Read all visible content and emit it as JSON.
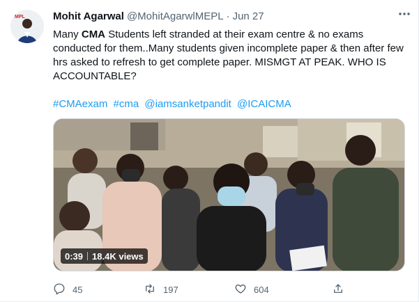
{
  "tweet": {
    "author_name": "Mohit Agarwal",
    "author_handle": "@MohitAgarwlMEPL",
    "separator": "·",
    "time": "Jun 27",
    "avatar_badge_text": "MPL",
    "text_line_prefix": "Many ",
    "text_bold": "CMA",
    "text_rest": " Students left stranded at their exam centre & no exams conducted for them..Many students given incomplete paper & then after few hrs asked to refresh to get complete paper. MISMGT AT PEAK. WHO IS ACCOUNTABLE?",
    "hashtags": [
      "#CMAexam",
      "#cma",
      "@iamsanketpandit",
      "@ICAICMA"
    ],
    "video": {
      "duration": "0:39",
      "views": "18.4K views"
    },
    "actions": {
      "reply_count": "45",
      "retweet_count": "197",
      "like_count": "604",
      "share_count": ""
    }
  },
  "colors": {
    "link": "#1d9bf0",
    "secondary_text": "#536471",
    "border": "#cfd9de"
  },
  "icons": [
    "more-icon",
    "reply-icon",
    "retweet-icon",
    "like-icon",
    "share-icon"
  ]
}
